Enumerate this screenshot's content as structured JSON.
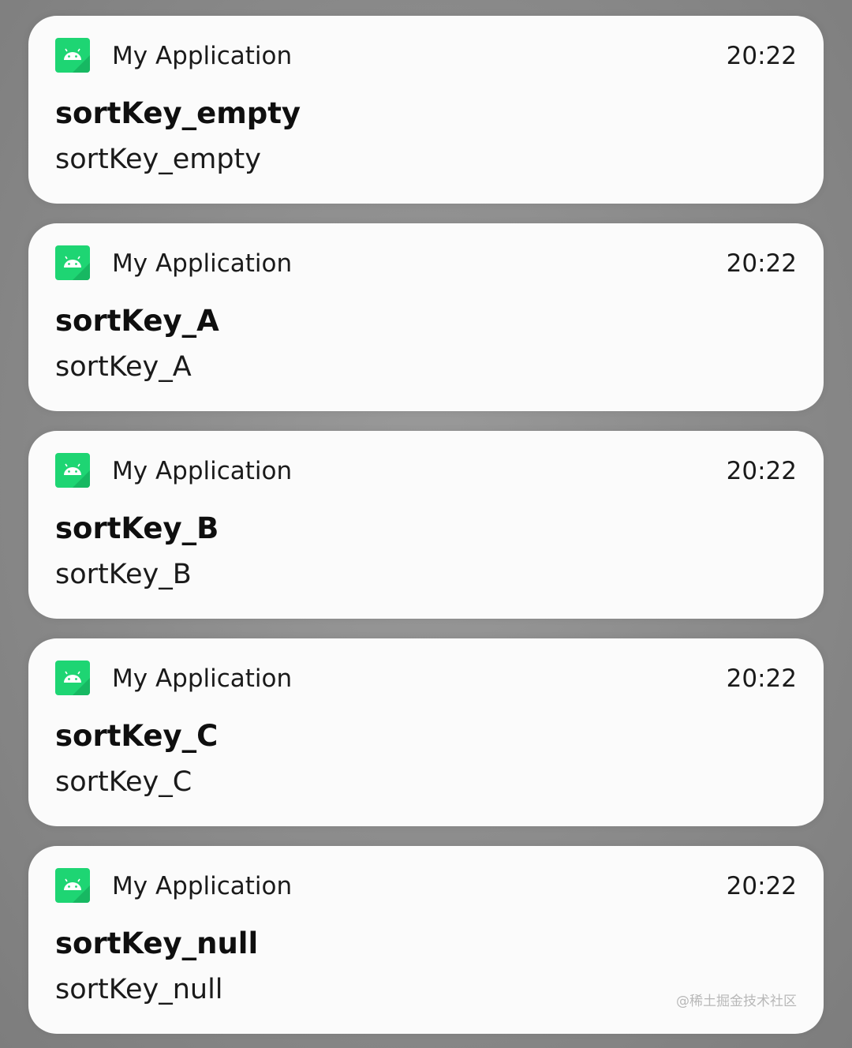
{
  "notifications": [
    {
      "app_name": "My Application",
      "time": "20:22",
      "title": "sortKey_empty",
      "text": "sortKey_empty"
    },
    {
      "app_name": "My Application",
      "time": "20:22",
      "title": "sortKey_A",
      "text": "sortKey_A"
    },
    {
      "app_name": "My Application",
      "time": "20:22",
      "title": "sortKey_B",
      "text": "sortKey_B"
    },
    {
      "app_name": "My Application",
      "time": "20:22",
      "title": "sortKey_C",
      "text": "sortKey_C"
    },
    {
      "app_name": "My Application",
      "time": "20:22",
      "title": "sortKey_null",
      "text": "sortKey_null"
    }
  ],
  "icons": {
    "app_icon": "android-robot-icon"
  },
  "colors": {
    "app_icon_bg": "#1ed573",
    "card_bg": "#fbfbfb",
    "backdrop": "#8a8a8a"
  },
  "watermark": "@稀土掘金技术社区"
}
